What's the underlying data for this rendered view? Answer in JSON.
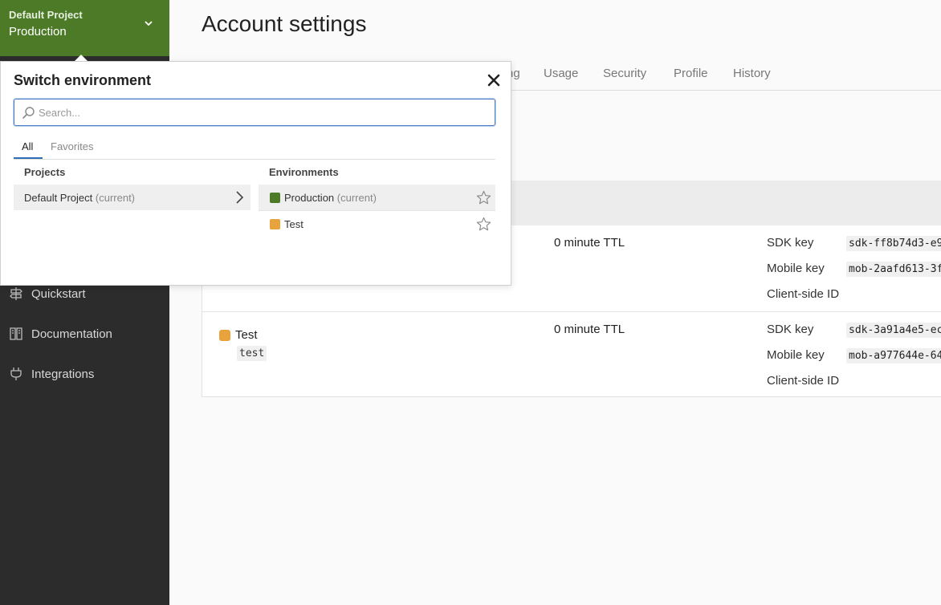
{
  "sidebar": {
    "env_switcher": {
      "project": "Default Project",
      "environment": "Production",
      "chevron_icon": "chevron-down-icon"
    },
    "nav_items": [
      {
        "label": "Quickstart",
        "icon": "signpost-icon"
      },
      {
        "label": "Documentation",
        "icon": "book-icon"
      },
      {
        "label": "Integrations",
        "icon": "plug-icon"
      }
    ]
  },
  "main": {
    "title": "Account settings",
    "tabs": [
      "ng",
      "Usage",
      "Security",
      "Profile",
      "History"
    ],
    "environments": [
      {
        "name": "",
        "key": "",
        "color": "#4c7a27",
        "ttl": "0 minute TTL",
        "sdk_key_label": "SDK key",
        "sdk_key": "sdk-ff8b74d3-e9",
        "mobile_key_label": "Mobile key",
        "mobile_key": "mob-2aafd613-3f",
        "client_id_label": "Client-side ID"
      },
      {
        "name": "Test",
        "key": "test",
        "color": "#e8a33d",
        "ttl": "0 minute TTL",
        "sdk_key_label": "SDK key",
        "sdk_key": "sdk-3a91a4e5-ec",
        "mobile_key_label": "Mobile key",
        "mobile_key": "mob-a977644e-64",
        "client_id_label": "Client-side ID"
      }
    ]
  },
  "popover": {
    "title": "Switch environment",
    "close_icon": "close-icon",
    "search": {
      "placeholder": "Search...",
      "value": ""
    },
    "tabs": [
      {
        "label": "All",
        "active": true
      },
      {
        "label": "Favorites",
        "active": false
      }
    ],
    "projects_heading": "Projects",
    "environments_heading": "Environments",
    "projects": [
      {
        "name": "Default Project",
        "suffix": "(current)"
      }
    ],
    "environments": [
      {
        "name": "Production",
        "suffix": "(current)",
        "color": "#4c7a27",
        "current": true
      },
      {
        "name": "Test",
        "suffix": "",
        "color": "#e8a33d",
        "current": false
      }
    ]
  }
}
